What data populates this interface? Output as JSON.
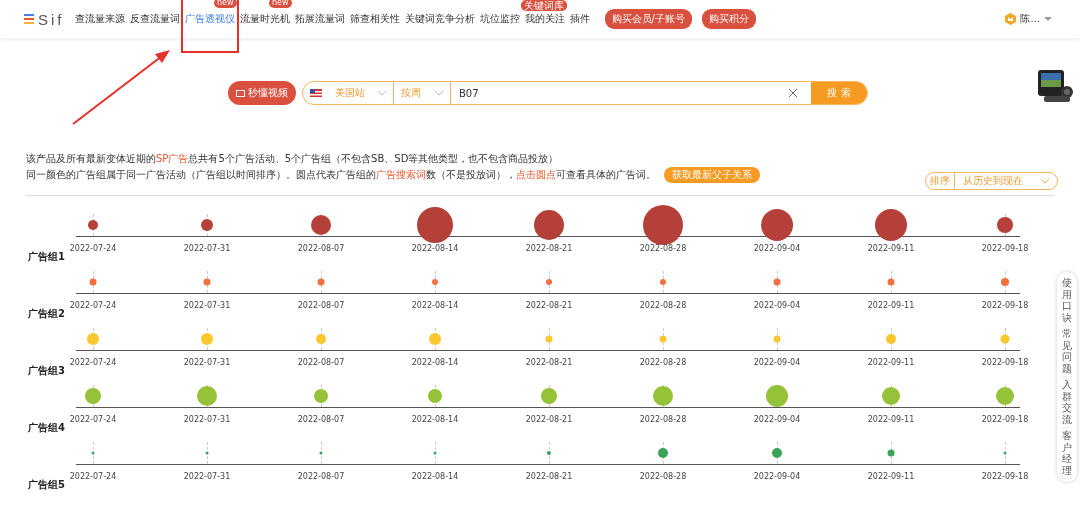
{
  "logo": {
    "text": "Sif"
  },
  "nav": {
    "items": [
      {
        "label": "查流量来源",
        "selected": false
      },
      {
        "label": "反查流量词",
        "selected": false
      },
      {
        "label": "广告透视仪",
        "selected": true,
        "badge": "new"
      },
      {
        "label": "流量时光机",
        "selected": false,
        "badge": "new"
      },
      {
        "label": "拓展流量词",
        "selected": false
      },
      {
        "label": "筛查相关性",
        "selected": false
      },
      {
        "label": "关键词竞争分析",
        "selected": false
      },
      {
        "label": "坑位监控",
        "selected": false
      },
      {
        "label": "我的关注",
        "selected": false,
        "badge": "关键词库"
      },
      {
        "label": "插件",
        "selected": false
      }
    ],
    "buttons": [
      "购买会员/子账号",
      "购买积分"
    ],
    "user": "陈..."
  },
  "search": {
    "video_button": "秒懂视频",
    "site": "美国站",
    "period": "按周",
    "value": "B07",
    "submit": "搜 索"
  },
  "info": {
    "line_1_parts": [
      {
        "text": "该产品及所有最新变体近期的",
        "highlight": false
      },
      {
        "text": "SP广告",
        "highlight": true
      },
      {
        "text": "总共有5个广告活动、5个广告组（不包含SB、SD等其他类型，也不包含商品投放）",
        "highlight": false
      }
    ],
    "line_2_parts": [
      {
        "text": "同一颜色的广告组属于同一广告活动（广告组以时间排序）。圆点代表广告组的",
        "highlight": false
      },
      {
        "text": "广告搜索词",
        "highlight": true
      },
      {
        "text": "数（不是投放词），",
        "highlight": false
      },
      {
        "text": "点击圆点",
        "highlight": true
      },
      {
        "text": "可查看具体的广告词。",
        "highlight": false
      }
    ],
    "button": "获取最新父子关系"
  },
  "sort": {
    "label": "排序",
    "value": "从历史到现在"
  },
  "groups": [
    {
      "label": "广告组1",
      "color": "#b5403a",
      "points": [
        {
          "date": "2022-07-24"
        },
        {
          "date": "2022-07-31"
        },
        {
          "date": "2022-08-07"
        },
        {
          "date": "2022-08-14"
        },
        {
          "date": "2022-08-21"
        },
        {
          "date": "2022-08-28"
        },
        {
          "date": "2022-09-04"
        },
        {
          "date": "2022-09-11"
        },
        {
          "date": "2022-09-18"
        }
      ]
    },
    {
      "label": "广告组2",
      "color": "#f0703f",
      "points": [
        {
          "date": "2022-07-24"
        },
        {
          "date": "2022-07-31"
        },
        {
          "date": "2022-08-07"
        },
        {
          "date": "2022-08-14"
        },
        {
          "date": "2022-08-21"
        },
        {
          "date": "2022-08-28"
        },
        {
          "date": "2022-09-04"
        },
        {
          "date": "2022-09-11"
        },
        {
          "date": "2022-09-18"
        }
      ]
    },
    {
      "label": "广告组3",
      "color": "#fbc72c",
      "points": [
        {
          "date": "2022-07-24"
        },
        {
          "date": "2022-07-31"
        },
        {
          "date": "2022-08-07"
        },
        {
          "date": "2022-08-14"
        },
        {
          "date": "2022-08-21"
        },
        {
          "date": "2022-08-28"
        },
        {
          "date": "2022-09-04"
        },
        {
          "date": "2022-09-11"
        },
        {
          "date": "2022-09-18"
        }
      ]
    },
    {
      "label": "广告组4",
      "color": "#96c23a",
      "points": [
        {
          "date": "2022-07-24"
        },
        {
          "date": "2022-07-31"
        },
        {
          "date": "2022-08-07"
        },
        {
          "date": "2022-08-14"
        },
        {
          "date": "2022-08-21"
        },
        {
          "date": "2022-08-28"
        },
        {
          "date": "2022-09-04"
        },
        {
          "date": "2022-09-11"
        },
        {
          "date": "2022-09-18"
        }
      ]
    },
    {
      "label": "广告组5",
      "color": "#3aa35a",
      "points": [
        {
          "date": "2022-07-24"
        },
        {
          "date": "2022-07-31"
        },
        {
          "date": "2022-08-07"
        },
        {
          "date": "2022-08-14"
        },
        {
          "date": "2022-08-21"
        },
        {
          "date": "2022-08-28"
        },
        {
          "date": "2022-09-04"
        },
        {
          "date": "2022-09-11"
        },
        {
          "date": "2022-09-18"
        }
      ]
    }
  ],
  "side_menu": [
    "使用口诀",
    "常见问题",
    "入群交流",
    "客户经理"
  ]
}
